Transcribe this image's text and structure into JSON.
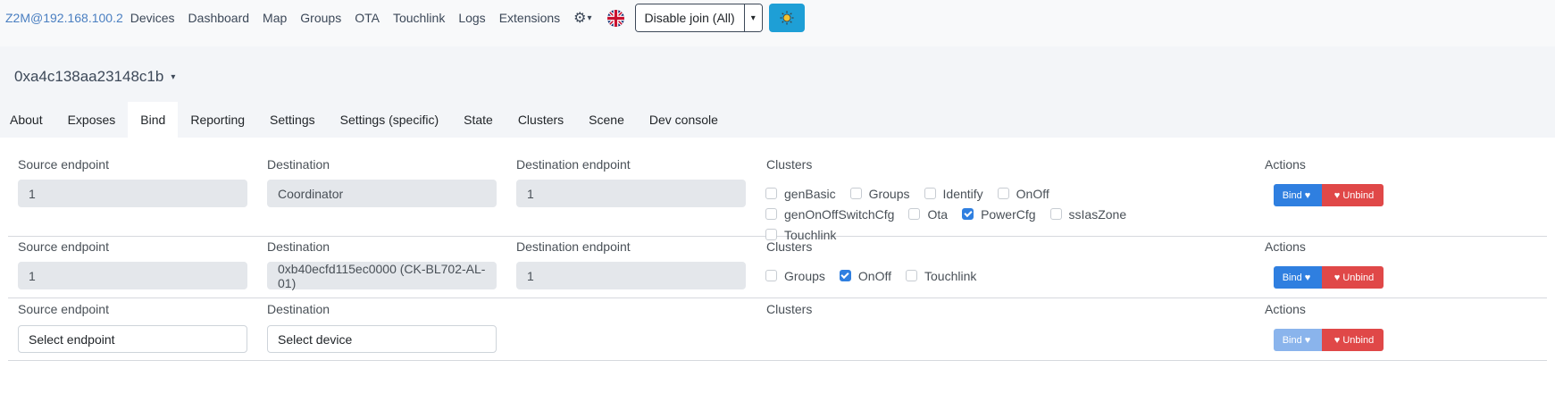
{
  "nav": {
    "brand": "Z2M@192.168.100.2",
    "links": [
      "Devices",
      "Dashboard",
      "Map",
      "Groups",
      "OTA",
      "Touchlink",
      "Logs",
      "Extensions"
    ],
    "join_label": "Disable join (All)"
  },
  "device": {
    "title": "0xa4c138aa23148c1b"
  },
  "tabs": [
    "About",
    "Exposes",
    "Bind",
    "Reporting",
    "Settings",
    "Settings (specific)",
    "State",
    "Clusters",
    "Scene",
    "Dev console"
  ],
  "active_tab": "Bind",
  "labels": {
    "source": "Source endpoint",
    "destination": "Destination",
    "dest_endpoint": "Destination endpoint",
    "clusters": "Clusters",
    "actions": "Actions",
    "bind": "Bind",
    "unbind": "Unbind"
  },
  "rows": [
    {
      "source": "1",
      "destination": "Coordinator",
      "dest_endpoint": "1",
      "clusters": [
        {
          "name": "genBasic",
          "checked": false
        },
        {
          "name": "Groups",
          "checked": false
        },
        {
          "name": "Identify",
          "checked": false
        },
        {
          "name": "OnOff",
          "checked": false
        },
        {
          "name": "genOnOffSwitchCfg",
          "checked": false
        },
        {
          "name": "Ota",
          "checked": false
        },
        {
          "name": "PowerCfg",
          "checked": true
        },
        {
          "name": "ssIasZone",
          "checked": false
        },
        {
          "name": "Touchlink",
          "checked": false
        }
      ]
    },
    {
      "source": "1",
      "destination": "0xb40ecfd115ec0000 (CK-BL702-AL-01)",
      "dest_endpoint": "1",
      "clusters": [
        {
          "name": "Groups",
          "checked": false
        },
        {
          "name": "OnOff",
          "checked": true
        },
        {
          "name": "Touchlink",
          "checked": false
        }
      ]
    },
    {
      "source": "Select endpoint",
      "destination": "Select device",
      "bind_disabled": true
    }
  ]
}
